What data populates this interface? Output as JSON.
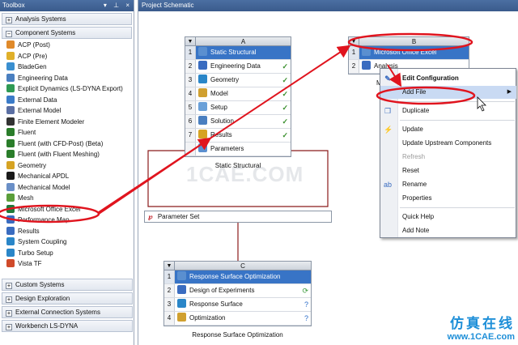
{
  "toolbox": {
    "title": "Toolbox",
    "controls": "▾ ⊥ ×",
    "categories_top": [
      {
        "label": "Analysis Systems",
        "state": "+"
      },
      {
        "label": "Component Systems",
        "state": "−"
      }
    ],
    "items": [
      {
        "label": "ACP (Post)",
        "icon": "acp-post-icon",
        "color": "#e08a2a"
      },
      {
        "label": "ACP (Pre)",
        "icon": "acp-pre-icon",
        "color": "#e0b02a"
      },
      {
        "label": "BladeGen",
        "icon": "bladegen-icon",
        "color": "#3a8fd0"
      },
      {
        "label": "Engineering Data",
        "icon": "engineering-data-icon",
        "color": "#4a7fc0"
      },
      {
        "label": "Explicit Dynamics (LS-DYNA Export)",
        "icon": "explicit-dynamics-icon",
        "color": "#2f9a54"
      },
      {
        "label": "External Data",
        "icon": "external-data-icon",
        "color": "#3b7bc8"
      },
      {
        "label": "External Model",
        "icon": "external-model-icon",
        "color": "#5b6fa3"
      },
      {
        "label": "Finite Element Modeler",
        "icon": "fem-icon",
        "color": "#333333"
      },
      {
        "label": "Fluent",
        "icon": "fluent-icon",
        "color": "#2a7d2a"
      },
      {
        "label": "Fluent (with CFD-Post) (Beta)",
        "icon": "fluent-cfd-post-icon",
        "color": "#2a7d2a"
      },
      {
        "label": "Fluent (with Fluent Meshing)",
        "icon": "fluent-meshing-icon",
        "color": "#2a7d2a"
      },
      {
        "label": "Geometry",
        "icon": "geometry-icon",
        "color": "#d6a323"
      },
      {
        "label": "Mechanical APDL",
        "icon": "mechanical-apdl-icon",
        "color": "#1a1a1a"
      },
      {
        "label": "Mechanical Model",
        "icon": "mechanical-model-icon",
        "color": "#6a8fc7"
      },
      {
        "label": "Mesh",
        "icon": "mesh-icon",
        "color": "#5a9e3a"
      },
      {
        "label": "Microsoft Office Excel",
        "icon": "excel-icon",
        "color": "#1f7a3a"
      },
      {
        "label": "Performance Map",
        "icon": "performance-map-icon",
        "color": "#3a6cc0"
      },
      {
        "label": "Results",
        "icon": "results-icon",
        "color": "#3a6cc0"
      },
      {
        "label": "System Coupling",
        "icon": "system-coupling-icon",
        "color": "#2a86c8"
      },
      {
        "label": "Turbo Setup",
        "icon": "turbo-setup-icon",
        "color": "#2a86c8"
      },
      {
        "label": "Vista TF",
        "icon": "vista-tf-icon",
        "color": "#d04a2a"
      }
    ],
    "categories_bottom": [
      {
        "label": "Custom Systems",
        "state": "+"
      },
      {
        "label": "Design Exploration",
        "state": "+"
      },
      {
        "label": "External Connection Systems",
        "state": "+"
      },
      {
        "label": "Workbench LS-DYNA",
        "state": "+"
      }
    ]
  },
  "schematic": {
    "title": "Project Schematic",
    "system_a": {
      "letter": "A",
      "caption": "Static Structural",
      "rows": [
        {
          "num": "1",
          "label": "Static Structural",
          "icon": "static-structural-icon",
          "status": ""
        },
        {
          "num": "2",
          "label": "Engineering Data",
          "icon": "engineering-data-icon",
          "status": "✓"
        },
        {
          "num": "3",
          "label": "Geometry",
          "icon": "geometry-icon",
          "status": "✓"
        },
        {
          "num": "4",
          "label": "Model",
          "icon": "model-icon",
          "status": "✓"
        },
        {
          "num": "5",
          "label": "Setup",
          "icon": "setup-icon",
          "status": "✓"
        },
        {
          "num": "6",
          "label": "Solution",
          "icon": "solution-icon",
          "status": "✓"
        },
        {
          "num": "7",
          "label": "Results",
          "icon": "results-icon",
          "status": "✓"
        },
        {
          "num": "",
          "label": "Parameters",
          "icon": "parameters-icon",
          "status": ""
        }
      ]
    },
    "system_b": {
      "letter": "B",
      "rows": [
        {
          "num": "1",
          "label": "Microsoft Office Excel",
          "icon": "excel-icon"
        },
        {
          "num": "2",
          "label": "Analysis",
          "icon": "analysis-icon"
        }
      ],
      "caption_partial": "M"
    },
    "system_c": {
      "letter": "C",
      "caption": "Response Surface Optimization",
      "rows": [
        {
          "num": "1",
          "label": "Response Surface Optimization",
          "icon": "rso-icon",
          "status": ""
        },
        {
          "num": "2",
          "label": "Design of Experiments",
          "icon": "doe-icon",
          "status": "⟳"
        },
        {
          "num": "3",
          "label": "Response Surface",
          "icon": "response-surface-icon",
          "status": "?"
        },
        {
          "num": "4",
          "label": "Optimization",
          "icon": "optimization-icon",
          "status": "?"
        }
      ]
    },
    "parameter_set": "Parameter Set",
    "watermark": "1CAE.COM"
  },
  "context_menu": {
    "items": [
      {
        "label": "Edit Configuration",
        "icon": "edit-icon",
        "bold": true
      },
      {
        "label": "Add File",
        "icon": "",
        "submenu": true,
        "highlight": true
      },
      {
        "label": "Duplicate",
        "icon": "duplicate-icon"
      },
      {
        "label": "Update",
        "icon": "update-icon"
      },
      {
        "label": "Update Upstream Components",
        "icon": ""
      },
      {
        "label": "Refresh",
        "icon": "",
        "disabled": true
      },
      {
        "label": "Reset",
        "icon": ""
      },
      {
        "label": "Rename",
        "icon": "rename-icon"
      },
      {
        "label": "Properties",
        "icon": ""
      },
      {
        "label": "Quick Help",
        "icon": ""
      },
      {
        "label": "Add Note",
        "icon": ""
      }
    ]
  },
  "branding": {
    "chinese": "仿真在线",
    "url": "www.1CAE.com"
  },
  "colors": {
    "accent": "#3874c6",
    "annotation": "#e0141e",
    "link_line": "#8b1a1a"
  }
}
